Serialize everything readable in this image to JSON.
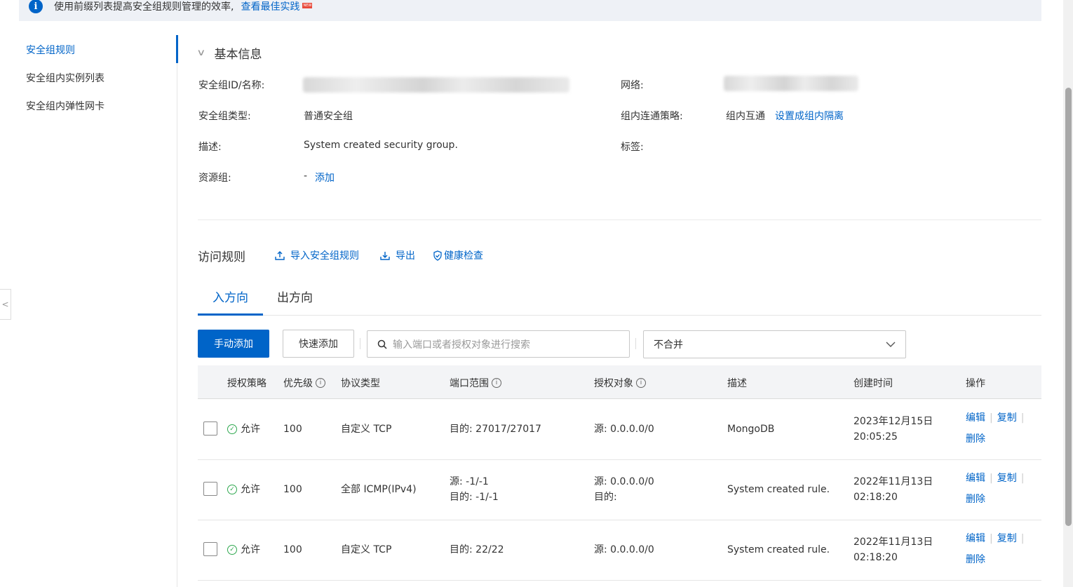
{
  "notice": {
    "icon": "info-icon",
    "text": "使用前缀列表提高安全组规则管理的效率,",
    "link": "查看最佳实践",
    "badge": "NEW"
  },
  "sidebar": {
    "items": [
      {
        "label": "安全组规则",
        "active": true
      },
      {
        "label": "安全组内实例列表",
        "active": false
      },
      {
        "label": "安全组内弹性网卡",
        "active": false
      }
    ]
  },
  "basic_info": {
    "title": "基本信息",
    "id_label": "安全组ID/名称:",
    "network_label": "网络:",
    "type_label": "安全组类型:",
    "type_value": "普通安全组",
    "policy_label": "组内连通策略:",
    "policy_value": "组内互通",
    "policy_link": "设置成组内隔离",
    "desc_label": "描述:",
    "desc_value": "System created security group.",
    "tag_label": "标签:",
    "rg_label": "资源组:",
    "rg_value": "-",
    "rg_link": "添加"
  },
  "rules": {
    "title": "访问规则",
    "import": "导入安全组规则",
    "export": "导出",
    "health": "健康检查",
    "tabs": [
      "入方向",
      "出方向"
    ],
    "add_manual": "手动添加",
    "add_quick": "快速添加",
    "search_placeholder": "输入端口或者授权对象进行搜索",
    "merge_select": "不合并",
    "headers": [
      "授权策略",
      "优先级",
      "协议类型",
      "端口范围",
      "授权对象",
      "描述",
      "创建时间",
      "操作"
    ],
    "rows": [
      {
        "policy": "允许",
        "priority": "100",
        "protocol": "自定义 TCP",
        "port1": "目的: 27017/27017",
        "port2": "",
        "target1": "源: 0.0.0.0/0",
        "target2": "",
        "desc": "MongoDB",
        "time1": "2023年12月15日",
        "time2": "20:05:25"
      },
      {
        "policy": "允许",
        "priority": "100",
        "protocol": "全部 ICMP(IPv4)",
        "port1": "源: -1/-1",
        "port2": "目的: -1/-1",
        "target1": "源: 0.0.0.0/0",
        "target2": "目的:",
        "desc": "System created rule.",
        "time1": "2022年11月13日",
        "time2": "02:18:20"
      },
      {
        "policy": "允许",
        "priority": "100",
        "protocol": "自定义 TCP",
        "port1": "目的: 22/22",
        "port2": "",
        "target1": "源: 0.0.0.0/0",
        "target2": "",
        "desc": "System created rule.",
        "time1": "2022年11月13日",
        "time2": "02:18:20"
      }
    ],
    "ops": {
      "edit": "编辑",
      "copy": "复制",
      "delete": "删除"
    }
  },
  "colors": {
    "accent": "#0064c8",
    "allow": "#2fa84f"
  }
}
